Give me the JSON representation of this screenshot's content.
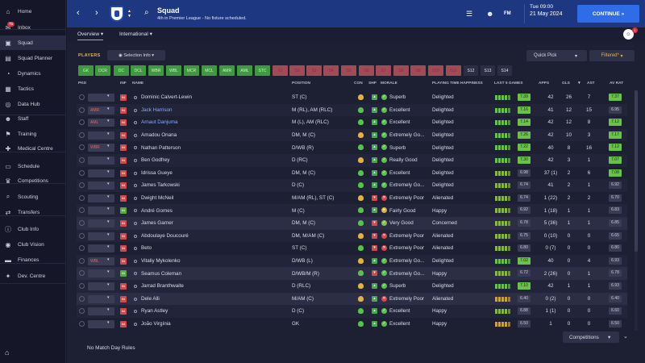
{
  "sidebar": {
    "items": [
      {
        "label": "Home",
        "icon": "home-icon",
        "glyph": "⌂"
      },
      {
        "label": "Inbox",
        "icon": "inbox-icon",
        "glyph": "✉",
        "badge": "75"
      },
      {
        "label": "Squad",
        "icon": "squad-icon",
        "glyph": "▣",
        "active": true
      },
      {
        "label": "Squad Planner",
        "icon": "squad-planner-icon",
        "glyph": "▤"
      },
      {
        "label": "Dynamics",
        "icon": "dynamics-icon",
        "glyph": "◔"
      },
      {
        "label": "Tactics",
        "icon": "tactics-icon",
        "glyph": "▦"
      },
      {
        "label": "Data Hub",
        "icon": "data-hub-icon",
        "glyph": "◎"
      },
      {
        "label": "Staff",
        "icon": "staff-icon",
        "glyph": "☻"
      },
      {
        "label": "Training",
        "icon": "training-icon",
        "glyph": "⚑"
      },
      {
        "label": "Medical Centre",
        "icon": "medical-icon",
        "glyph": "✚"
      },
      {
        "label": "Schedule",
        "icon": "schedule-icon",
        "glyph": "▭"
      },
      {
        "label": "Competitions",
        "icon": "competitions-icon",
        "glyph": "♛"
      },
      {
        "label": "Scouting",
        "icon": "scouting-icon",
        "glyph": "⌕"
      },
      {
        "label": "Transfers",
        "icon": "transfers-icon",
        "glyph": "⇄"
      },
      {
        "label": "Club Info",
        "icon": "club-info-icon",
        "glyph": "ⓘ"
      },
      {
        "label": "Club Vision",
        "icon": "club-vision-icon",
        "glyph": "◉"
      },
      {
        "label": "Finances",
        "icon": "finances-icon",
        "glyph": "▬"
      },
      {
        "label": "Dev. Centre",
        "icon": "dev-centre-icon",
        "glyph": "✦"
      }
    ],
    "bottom_icon": "home-icon"
  },
  "header": {
    "title": "Squad",
    "subtitle": "4th in Premier League - No fixture scheduled.",
    "date_day": "Tue 09:00",
    "date": "21 May 2024",
    "continue": "CONTINUE",
    "fm": "FM"
  },
  "tabs": {
    "overview": "Overview",
    "international": "International"
  },
  "toolbar": {
    "players": "PLAYERS",
    "selection_info": "Selection Info",
    "quick_pick": "Quick Pick",
    "filtered": "Filtered*"
  },
  "positions": [
    "GK",
    "DCR",
    "DC",
    "DCL",
    "WBR",
    "WBL",
    "MCR",
    "MCL",
    "AMR",
    "AML",
    "STC",
    "S1",
    "S2",
    "S3",
    "S4",
    "S5",
    "S6",
    "S7",
    "S8",
    "S9",
    "S10",
    "S11",
    "S12",
    "S13",
    "S14",
    "S15"
  ],
  "columns": {
    "pkd": "PKD",
    "inf": "INF",
    "name": "NAME",
    "position": "POSITION",
    "con": "CON",
    "shp": "SHP",
    "morale": "MORALE",
    "playing_time": "PLAYING TIME HAPPINESS",
    "last5": "LAST 5 GAMES",
    "apps": "APPS",
    "gls": "GLS",
    "ast": "AST",
    "av_rat": "AV RAT"
  },
  "players": [
    {
      "slot": "",
      "name": "Dominic Calvert-Lewin",
      "position": "ST (C)",
      "morale": "Superb",
      "pt": "Delighted",
      "last5": "7.39",
      "apps": "42",
      "gls": "26",
      "ast": "7",
      "avrat": "7.37"
    },
    {
      "slot": "AMR",
      "name": "Jack Harrison",
      "position": "M (RL), AM (RLC)",
      "morale": "Excellent",
      "pt": "Delighted",
      "last5": "7.16",
      "apps": "41",
      "gls": "12",
      "ast": "15",
      "avrat": "6.95"
    },
    {
      "slot": "AML",
      "name": "Arnaut Danjuma",
      "position": "M (L), AM (RLC)",
      "morale": "Excellent",
      "pt": "Delighted",
      "last5": "7.14",
      "apps": "42",
      "gls": "12",
      "ast": "8",
      "avrat": "7.12"
    },
    {
      "slot": "",
      "name": "Amadou Onana",
      "position": "DM, M (C)",
      "morale": "Extremely Go...",
      "pt": "Delighted",
      "last5": "7.26",
      "apps": "42",
      "gls": "10",
      "ast": "3",
      "avrat": "7.17"
    },
    {
      "slot": "WBR",
      "name": "Nathan Patterson",
      "position": "D/WB (R)",
      "morale": "Superb",
      "pt": "Delighted",
      "last5": "7.22",
      "apps": "40",
      "gls": "8",
      "ast": "16",
      "avrat": "7.12"
    },
    {
      "slot": "",
      "name": "Ben Godfrey",
      "position": "D (RC)",
      "morale": "Really Good",
      "pt": "Delighted",
      "last5": "7.30",
      "apps": "42",
      "gls": "3",
      "ast": "1",
      "avrat": "7.07"
    },
    {
      "slot": "",
      "name": "Idrissa Gueye",
      "position": "DM, M (C)",
      "morale": "Excellent",
      "pt": "Delighted",
      "last5": "6.98",
      "apps": "37 (1)",
      "gls": "2",
      "ast": "6",
      "avrat": "7.08"
    },
    {
      "slot": "",
      "name": "James Tarkowski",
      "position": "D (C)",
      "morale": "Extremely Go...",
      "pt": "Delighted",
      "last5": "6.74",
      "apps": "41",
      "gls": "2",
      "ast": "1",
      "avrat": "6.92"
    },
    {
      "slot": "",
      "name": "Dwight McNeil",
      "position": "M/AM (RL), ST (C)",
      "morale": "Extremely Poor",
      "pt": "Alienated",
      "last5": "6.74",
      "apps": "1 (22)",
      "gls": "2",
      "ast": "2",
      "avrat": "6.70"
    },
    {
      "slot": "",
      "name": "André Gomes",
      "position": "M (C)",
      "morale": "Fairly Good",
      "pt": "Happy",
      "last5": "6.92",
      "apps": "1 (18)",
      "gls": "1",
      "ast": "1",
      "avrat": "6.83"
    },
    {
      "slot": "",
      "name": "James Garner",
      "position": "DM, M (C)",
      "morale": "Very Good",
      "pt": "Concerned",
      "last5": "6.78",
      "apps": "5 (36)",
      "gls": "1",
      "ast": "1",
      "avrat": "6.85"
    },
    {
      "slot": "",
      "name": "Abdoulaye Doucouré",
      "position": "DM, M/AM (C)",
      "morale": "Extremely Poor",
      "pt": "Alienated",
      "last5": "6.75",
      "apps": "0 (10)",
      "gls": "0",
      "ast": "0",
      "avrat": "6.65"
    },
    {
      "slot": "",
      "name": "Beto",
      "position": "ST (C)",
      "morale": "Extremely Poor",
      "pt": "Alienated",
      "last5": "6.80",
      "apps": "0 (7)",
      "gls": "0",
      "ast": "0",
      "avrat": "6.80"
    },
    {
      "slot": "WBL",
      "name": "Vitaliy Mykolenko",
      "position": "D/WB (L)",
      "morale": "Extremely Go...",
      "pt": "Delighted",
      "last5": "7.02",
      "apps": "40",
      "gls": "0",
      "ast": "4",
      "avrat": "6.93"
    },
    {
      "slot": "",
      "name": "Seamus Coleman",
      "position": "D/WB/M (R)",
      "morale": "Extremely Go...",
      "pt": "Happy",
      "last5": "6.72",
      "apps": "2 (26)",
      "gls": "0",
      "ast": "1",
      "avrat": "6.78"
    },
    {
      "slot": "",
      "name": "Jarrad Branthwaite",
      "position": "D (RLC)",
      "morale": "Superb",
      "pt": "Delighted",
      "last5": "7.10",
      "apps": "42",
      "gls": "1",
      "ast": "1",
      "avrat": "6.93"
    },
    {
      "slot": "",
      "name": "Dele Alli",
      "position": "M/AM (C)",
      "morale": "Extremely Poor",
      "pt": "Alienated",
      "last5": "6.40",
      "apps": "0 (2)",
      "gls": "0",
      "ast": "0",
      "avrat": "6.40"
    },
    {
      "slot": "",
      "name": "Ryan Astley",
      "position": "D (C)",
      "morale": "Excellent",
      "pt": "Happy",
      "last5": "6.88",
      "apps": "1 (1)",
      "gls": "0",
      "ast": "0",
      "avrat": "6.60"
    },
    {
      "slot": "",
      "name": "João Virgínia",
      "position": "GK",
      "morale": "Excellent",
      "pt": "Happy",
      "last5": "6.50",
      "apps": "1",
      "gls": "0",
      "ast": "0",
      "avrat": "6.50"
    }
  ],
  "footer": {
    "no_match": "No Match Day Rules",
    "competitions": "Competitions"
  },
  "colors": {
    "accent": "#2f6ce6",
    "topbar": "#1d3780",
    "gold": "#e0b342",
    "green": "#58c24a",
    "red": "#d94747"
  }
}
